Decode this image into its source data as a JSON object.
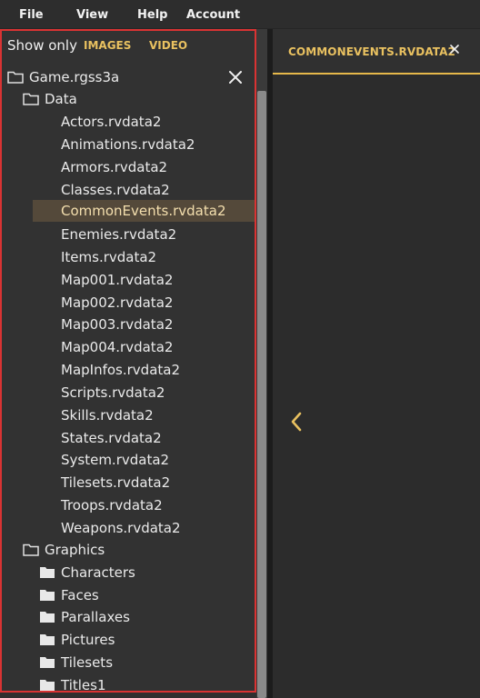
{
  "menu": {
    "items": [
      "File",
      "View",
      "Help",
      "Account"
    ]
  },
  "filter": {
    "label": "Show only",
    "options": [
      "IMAGES",
      "VIDEO"
    ]
  },
  "tree": {
    "root": "Game.rgss3a",
    "data_folder": "Data",
    "data_files": [
      "Actors.rvdata2",
      "Animations.rvdata2",
      "Armors.rvdata2",
      "Classes.rvdata2",
      "CommonEvents.rvdata2",
      "Enemies.rvdata2",
      "Items.rvdata2",
      "Map001.rvdata2",
      "Map002.rvdata2",
      "Map003.rvdata2",
      "Map004.rvdata2",
      "MapInfos.rvdata2",
      "Scripts.rvdata2",
      "Skills.rvdata2",
      "States.rvdata2",
      "System.rvdata2",
      "Tilesets.rvdata2",
      "Troops.rvdata2",
      "Weapons.rvdata2"
    ],
    "graphics_folder": "Graphics",
    "graphics_subfolders": [
      "Characters",
      "Faces",
      "Parallaxes",
      "Pictures",
      "Tilesets",
      "Titles1"
    ],
    "selected": "CommonEvents.rvdata2"
  },
  "viewer": {
    "tab_label": "COMMONEVENTS.RVDATA2"
  },
  "colors": {
    "accent": "#e9c160",
    "selection": "#54493a",
    "panel_border": "#d93333"
  },
  "icons": {
    "close": "close-icon",
    "folder_outline": "folder-outline-icon",
    "folder_filled": "folder-filled-icon",
    "chevron_left": "chevron-left-icon"
  }
}
